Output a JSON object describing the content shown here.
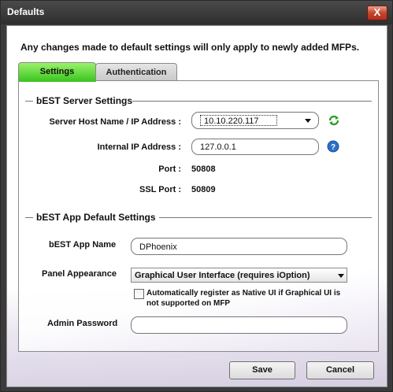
{
  "window": {
    "title": "Defaults",
    "close_glyph": "X"
  },
  "notice": "Any changes made to default settings will only apply to newly added MFPs.",
  "tabs": [
    {
      "label": "Settings",
      "active": true
    },
    {
      "label": "Authentication",
      "active": false
    }
  ],
  "server": {
    "section_title": "bEST Server Settings",
    "host_label": "Server Host Name / IP Address :",
    "host_value": "10.10.220.117",
    "internal_ip_label": "Internal IP Address :",
    "internal_ip_value": "127.0.0.1",
    "port_label": "Port :",
    "port_value": "50808",
    "ssl_port_label": "SSL Port :",
    "ssl_port_value": "50809"
  },
  "app": {
    "section_title": "bEST App Default Settings",
    "name_label": "bEST App Name",
    "name_value": "DPhoenix",
    "panel_label": "Panel Appearance",
    "panel_value": "Graphical User Interface (requires iOption)",
    "checkbox_label_line1": "Automatically register as Native UI if Graphical UI is",
    "checkbox_label_line2": "not supported on MFP",
    "checkbox_checked": false,
    "admin_password_label": "Admin Password",
    "admin_password_value": ""
  },
  "buttons": {
    "save": "Save",
    "cancel": "Cancel"
  },
  "colors": {
    "active_tab": "#39c31e",
    "refresh_icon": "#2f9d2a",
    "help_icon": "#2a6fc9"
  }
}
